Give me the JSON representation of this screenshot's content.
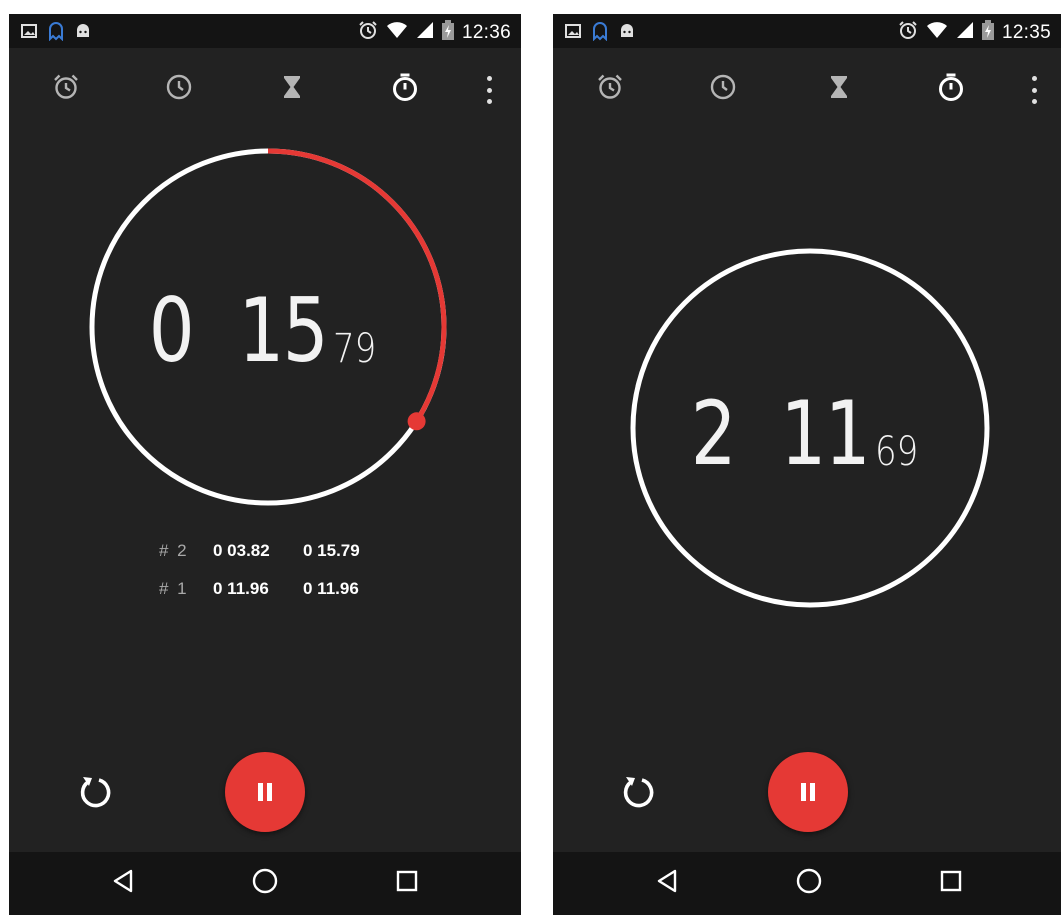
{
  "colors": {
    "background": "#222222",
    "bars": "#141414",
    "accent": "#e53935",
    "lap_number": "#a9a9a9",
    "text": "#ffffff"
  },
  "tabs": [
    "alarm-icon",
    "clock-icon",
    "timer-icon",
    "stopwatch-icon"
  ],
  "left": {
    "status": {
      "time": "12:36"
    },
    "stopwatch": {
      "minutes": "0",
      "seconds": "15",
      "hundredths": "79",
      "progress_fraction": 0.34
    },
    "laps": [
      {
        "number": "# 2",
        "lap_time": "0 03.82",
        "total_time": "0 15.79"
      },
      {
        "number": "# 1",
        "lap_time": "0 11.96",
        "total_time": "0 11.96"
      }
    ]
  },
  "right": {
    "status": {
      "time": "12:35"
    },
    "stopwatch": {
      "minutes": "2",
      "seconds": "11",
      "hundredths": "69"
    }
  }
}
